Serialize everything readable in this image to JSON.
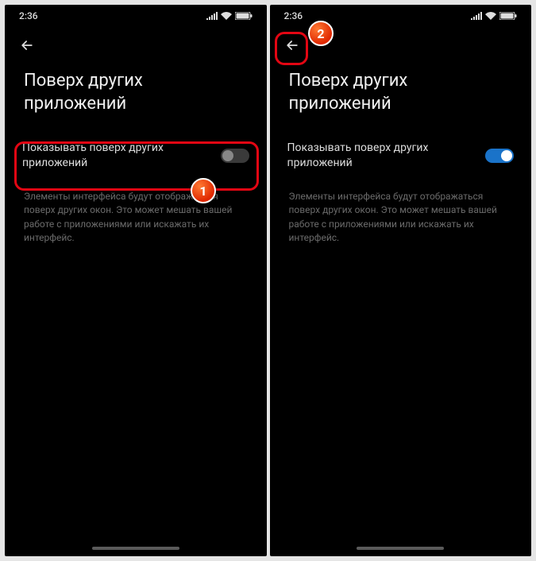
{
  "statusBar": {
    "time": "2:36"
  },
  "screens": {
    "left": {
      "title": "Поверх других приложений",
      "settingLabel": "Показывать поверх других приложений",
      "toggleState": "off",
      "description": "Элементы интерфейса будут отображаться поверх других окон. Это может мешать вашей работе с приложениями или искажать их интерфейс."
    },
    "right": {
      "title": "Поверх других приложений",
      "settingLabel": "Показывать поверх других приложений",
      "toggleState": "on",
      "description": "Элементы интерфейса будут отображаться поверх других окон. Это может мешать вашей работе с приложениями или искажать их интерфейс."
    }
  },
  "markers": {
    "one": "1",
    "two": "2"
  },
  "icons": {
    "back": "back-arrow-icon",
    "signal": "signal-icon",
    "wifi": "wifi-icon",
    "battery": "battery-icon"
  }
}
